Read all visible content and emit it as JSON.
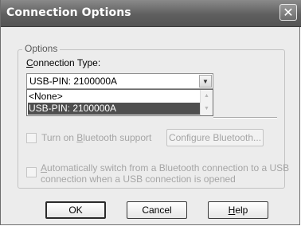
{
  "window": {
    "title": "Connection Options",
    "close_glyph": "✕"
  },
  "options_group": {
    "label": "Options",
    "connection_type_label_prefix": "",
    "connection_type_label_accel": "C",
    "connection_type_label_rest": "onnection Type:",
    "connection_type_value": "USB-PIN: 2100000A",
    "dropdown_items": [
      "<None>",
      "USB-PIN: 2100000A"
    ],
    "selected_index": 1,
    "bluetooth_label_prefix": "Turn on ",
    "bluetooth_label_accel": "B",
    "bluetooth_label_rest": "luetooth support",
    "configure_bluetooth_label": "Configure Bluetooth...",
    "auto_switch_line1_accel": "A",
    "auto_switch_line1_rest": "utomatically switch from a Bluetooth connection to a USB",
    "auto_switch_line2": "connection when a USB connection is opened"
  },
  "buttons": {
    "ok_label": "OK",
    "cancel_label": "Cancel",
    "help_accel": "H",
    "help_rest": "elp"
  },
  "icons": {
    "close": "close-icon",
    "dropdown_arrow": "chevron-down-icon",
    "scroll_up": "chevron-up-icon",
    "scroll_down": "chevron-down-icon"
  }
}
